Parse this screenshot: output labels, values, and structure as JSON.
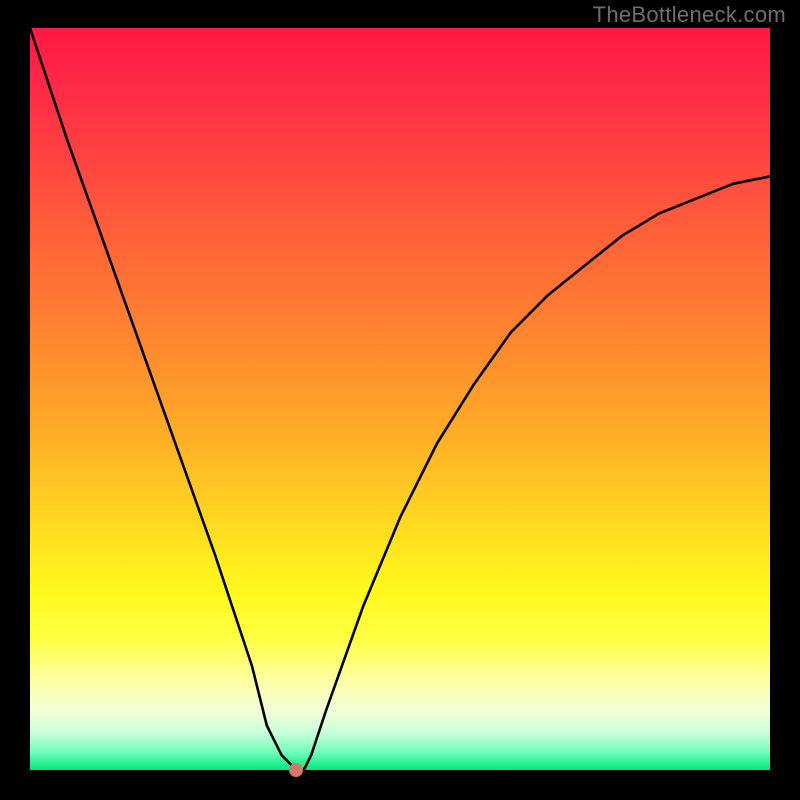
{
  "watermark": "TheBottleneck.com",
  "chart_data": {
    "type": "line",
    "title": "",
    "xlabel": "",
    "ylabel": "",
    "xlim": [
      0,
      100
    ],
    "ylim": [
      0,
      100
    ],
    "grid": false,
    "series": [
      {
        "name": "bottleneck-curve",
        "x": [
          0,
          5,
          10,
          15,
          20,
          25,
          30,
          32,
          34,
          35,
          36,
          37,
          38,
          40,
          45,
          50,
          55,
          60,
          65,
          70,
          75,
          80,
          85,
          90,
          95,
          100
        ],
        "values": [
          100,
          85,
          71,
          57,
          43,
          29,
          14,
          6,
          2,
          1,
          0,
          0,
          2,
          8,
          22,
          34,
          44,
          52,
          59,
          64,
          68,
          72,
          75,
          77,
          79,
          80
        ]
      }
    ],
    "minimum_marker": {
      "x": 36,
      "y": 0
    },
    "gradient_stops": [
      {
        "pos": 0,
        "color": "#ff1846"
      },
      {
        "pos": 0.5,
        "color": "#ffc823"
      },
      {
        "pos": 0.8,
        "color": "#ffff40"
      },
      {
        "pos": 1.0,
        "color": "#00e97e"
      }
    ]
  }
}
